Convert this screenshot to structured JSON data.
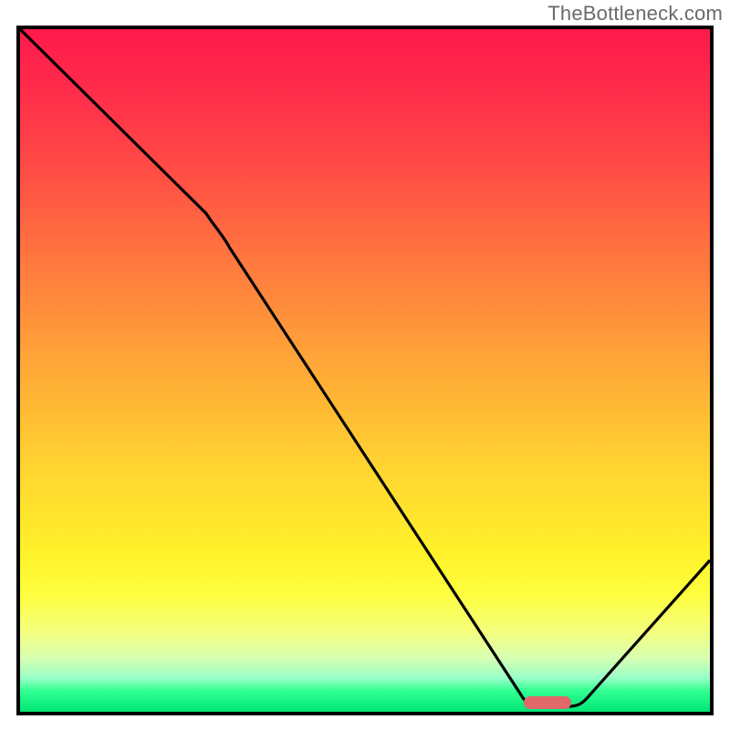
{
  "attribution": "TheBottleneck.com",
  "colors": {
    "gradient_top": "#ff1a4b",
    "gradient_mid": "#ffd630",
    "gradient_bottom": "#00e676",
    "curve_stroke": "#000000",
    "marker_fill": "#e06868",
    "frame_border": "#000000"
  },
  "chart_data": {
    "type": "line",
    "title": "",
    "xlabel": "",
    "ylabel": "",
    "x_range": [
      0,
      100
    ],
    "y_range": [
      0,
      100
    ],
    "curve": [
      {
        "x": 0,
        "y": 100
      },
      {
        "x": 27,
        "y": 73
      },
      {
        "x": 73,
        "y": 2
      },
      {
        "x": 80,
        "y": 2
      },
      {
        "x": 100,
        "y": 22
      }
    ],
    "marker": {
      "x_min": 73,
      "x_max": 80,
      "y": 2
    },
    "annotations": []
  }
}
